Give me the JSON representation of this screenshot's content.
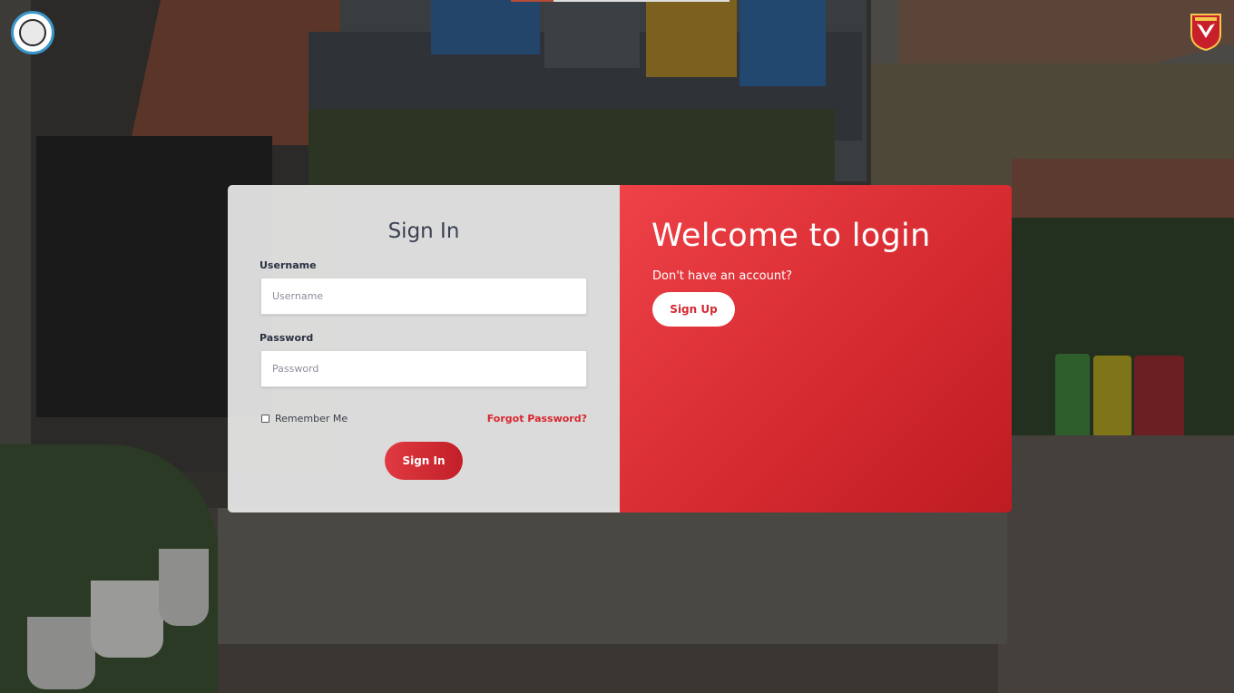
{
  "colors": {
    "accent": "#e03a42",
    "accent_dark": "#c21f28",
    "link": "#d9262f"
  },
  "logos": {
    "left": "school-emblem-icon",
    "right": "shield-emblem-icon"
  },
  "signin_form": {
    "title": "Sign In",
    "username_label": "Username",
    "username_placeholder": "Username",
    "username_value": "",
    "password_label": "Password",
    "password_placeholder": "Password",
    "password_value": "",
    "remember_label": "Remember Me",
    "remember_checked": false,
    "forgot_label": "Forgot Password?",
    "submit_label": "Sign In"
  },
  "welcome": {
    "title": "Welcome to login",
    "subtitle": "Don't have an account?",
    "signup_label": "Sign Up"
  }
}
